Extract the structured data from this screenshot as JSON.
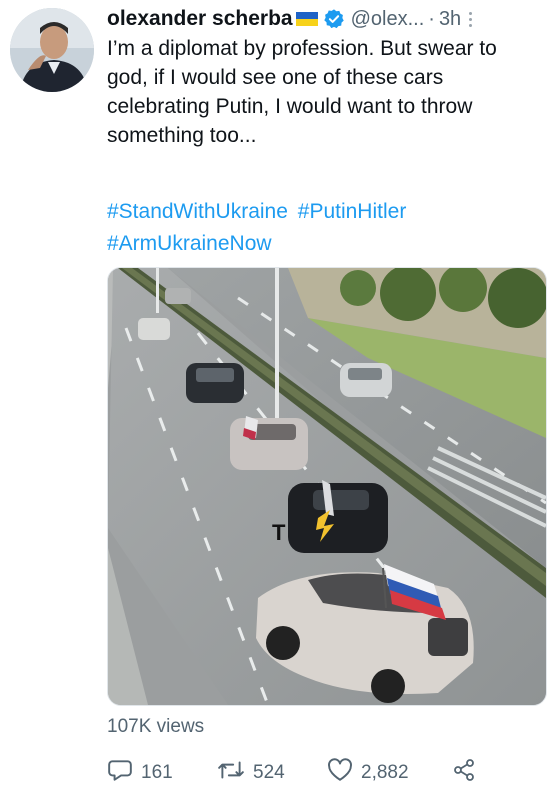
{
  "author": {
    "name": "olexander scherba",
    "handle": "@olex...",
    "time": "3h",
    "verified": true
  },
  "tweet": {
    "text": "I’m a diplomat by profession. But swear to god, if I would see one of these cars celebrating Putin, I would want to throw something too...",
    "hashtags": [
      "#StandWithUkraine",
      "#PutinHitler",
      "#ArmUkraineNow"
    ]
  },
  "media": {
    "watermark": "T",
    "type": "video"
  },
  "stats": {
    "views": "107K views",
    "replies": "161",
    "retweets": "524",
    "likes": "2,882"
  },
  "icons": {
    "reply": "reply-icon",
    "retweet": "retweet-icon",
    "like": "heart-icon",
    "share": "share-icon",
    "verified": "verified-badge-icon",
    "more": "more-options-icon"
  },
  "colors": {
    "link": "#1d9bf0",
    "secondary_text": "#536471",
    "flag_blue": "#1f63c6",
    "flag_yellow": "#f7d21a"
  }
}
